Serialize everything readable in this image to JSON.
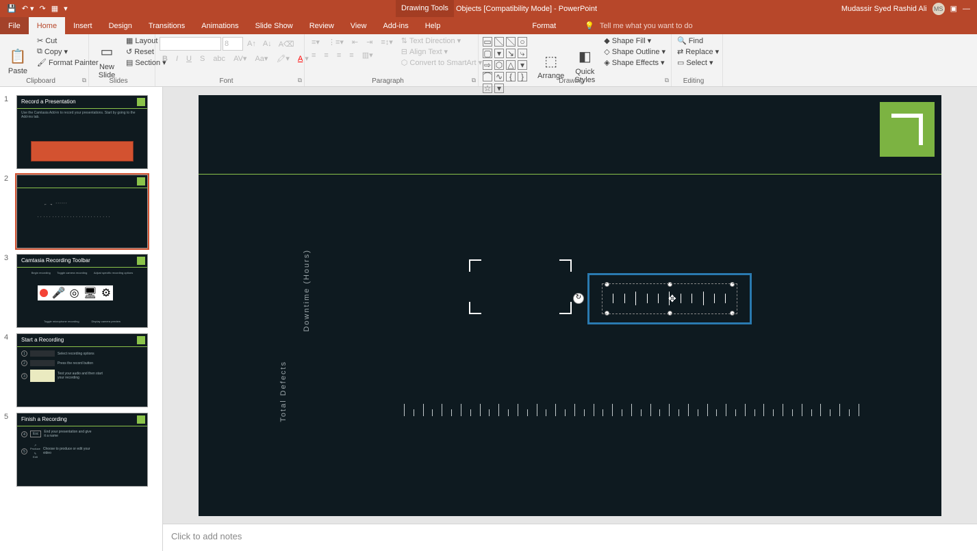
{
  "title_bar": {
    "drawing_tools": "Drawing Tools",
    "document_name": "Objects [Compatibility Mode]  -  PowerPoint",
    "user_name": "Mudassir Syed Rashid Ali",
    "user_initials": "MS"
  },
  "tabs": {
    "file": "File",
    "home": "Home",
    "insert": "Insert",
    "design": "Design",
    "transitions": "Transitions",
    "animations": "Animations",
    "slideshow": "Slide Show",
    "review": "Review",
    "view": "View",
    "addins": "Add-ins",
    "help": "Help",
    "format": "Format",
    "tellme": "Tell me what you want to do"
  },
  "ribbon": {
    "clipboard": {
      "label": "Clipboard",
      "paste": "Paste",
      "cut": "Cut",
      "copy": "Copy",
      "format_painter": "Format Painter"
    },
    "slides": {
      "label": "Slides",
      "new_slide": "New\nSlide",
      "layout": "Layout",
      "reset": "Reset",
      "section": "Section"
    },
    "font": {
      "label": "Font",
      "size": "8"
    },
    "paragraph": {
      "label": "Paragraph",
      "text_direction": "Text Direction",
      "align_text": "Align Text",
      "convert_smartart": "Convert to SmartArt"
    },
    "drawing": {
      "label": "Drawing",
      "arrange": "Arrange",
      "quick_styles": "Quick\nStyles",
      "shape_fill": "Shape Fill",
      "shape_outline": "Shape Outline",
      "shape_effects": "Shape Effects"
    },
    "editing": {
      "label": "Editing",
      "find": "Find",
      "replace": "Replace",
      "select": "Select"
    }
  },
  "thumbnails": [
    {
      "num": "1",
      "title": "Record a Presentation"
    },
    {
      "num": "2",
      "title": ""
    },
    {
      "num": "3",
      "title": "Camtasia Recording Toolbar"
    },
    {
      "num": "4",
      "title": "Start a Recording"
    },
    {
      "num": "5",
      "title": "Finish a Recording"
    }
  ],
  "thumb_details": {
    "slide1_subtitle": "Use the Camtasia Add-in to record your presentations. Start by going to the Add-ins tab.",
    "slide3_labels": [
      "Begin recording",
      "Toggle camera recording",
      "Adjust specific recording options",
      "Toggle microphone recording",
      "Display camera preview"
    ],
    "slide4_steps": [
      "Select recording options",
      "Press the record button",
      "Test your audio and then start your recording"
    ],
    "slide5_steps": [
      "End your presentation and give it a name",
      "Choose to produce or edit your video"
    ],
    "slide5_btns": [
      "Esc",
      "Produce",
      "Edit"
    ]
  },
  "canvas": {
    "label1": "Downtime (Hours)",
    "label2": "Total Defects"
  },
  "notes": {
    "placeholder": "Click to add notes"
  }
}
